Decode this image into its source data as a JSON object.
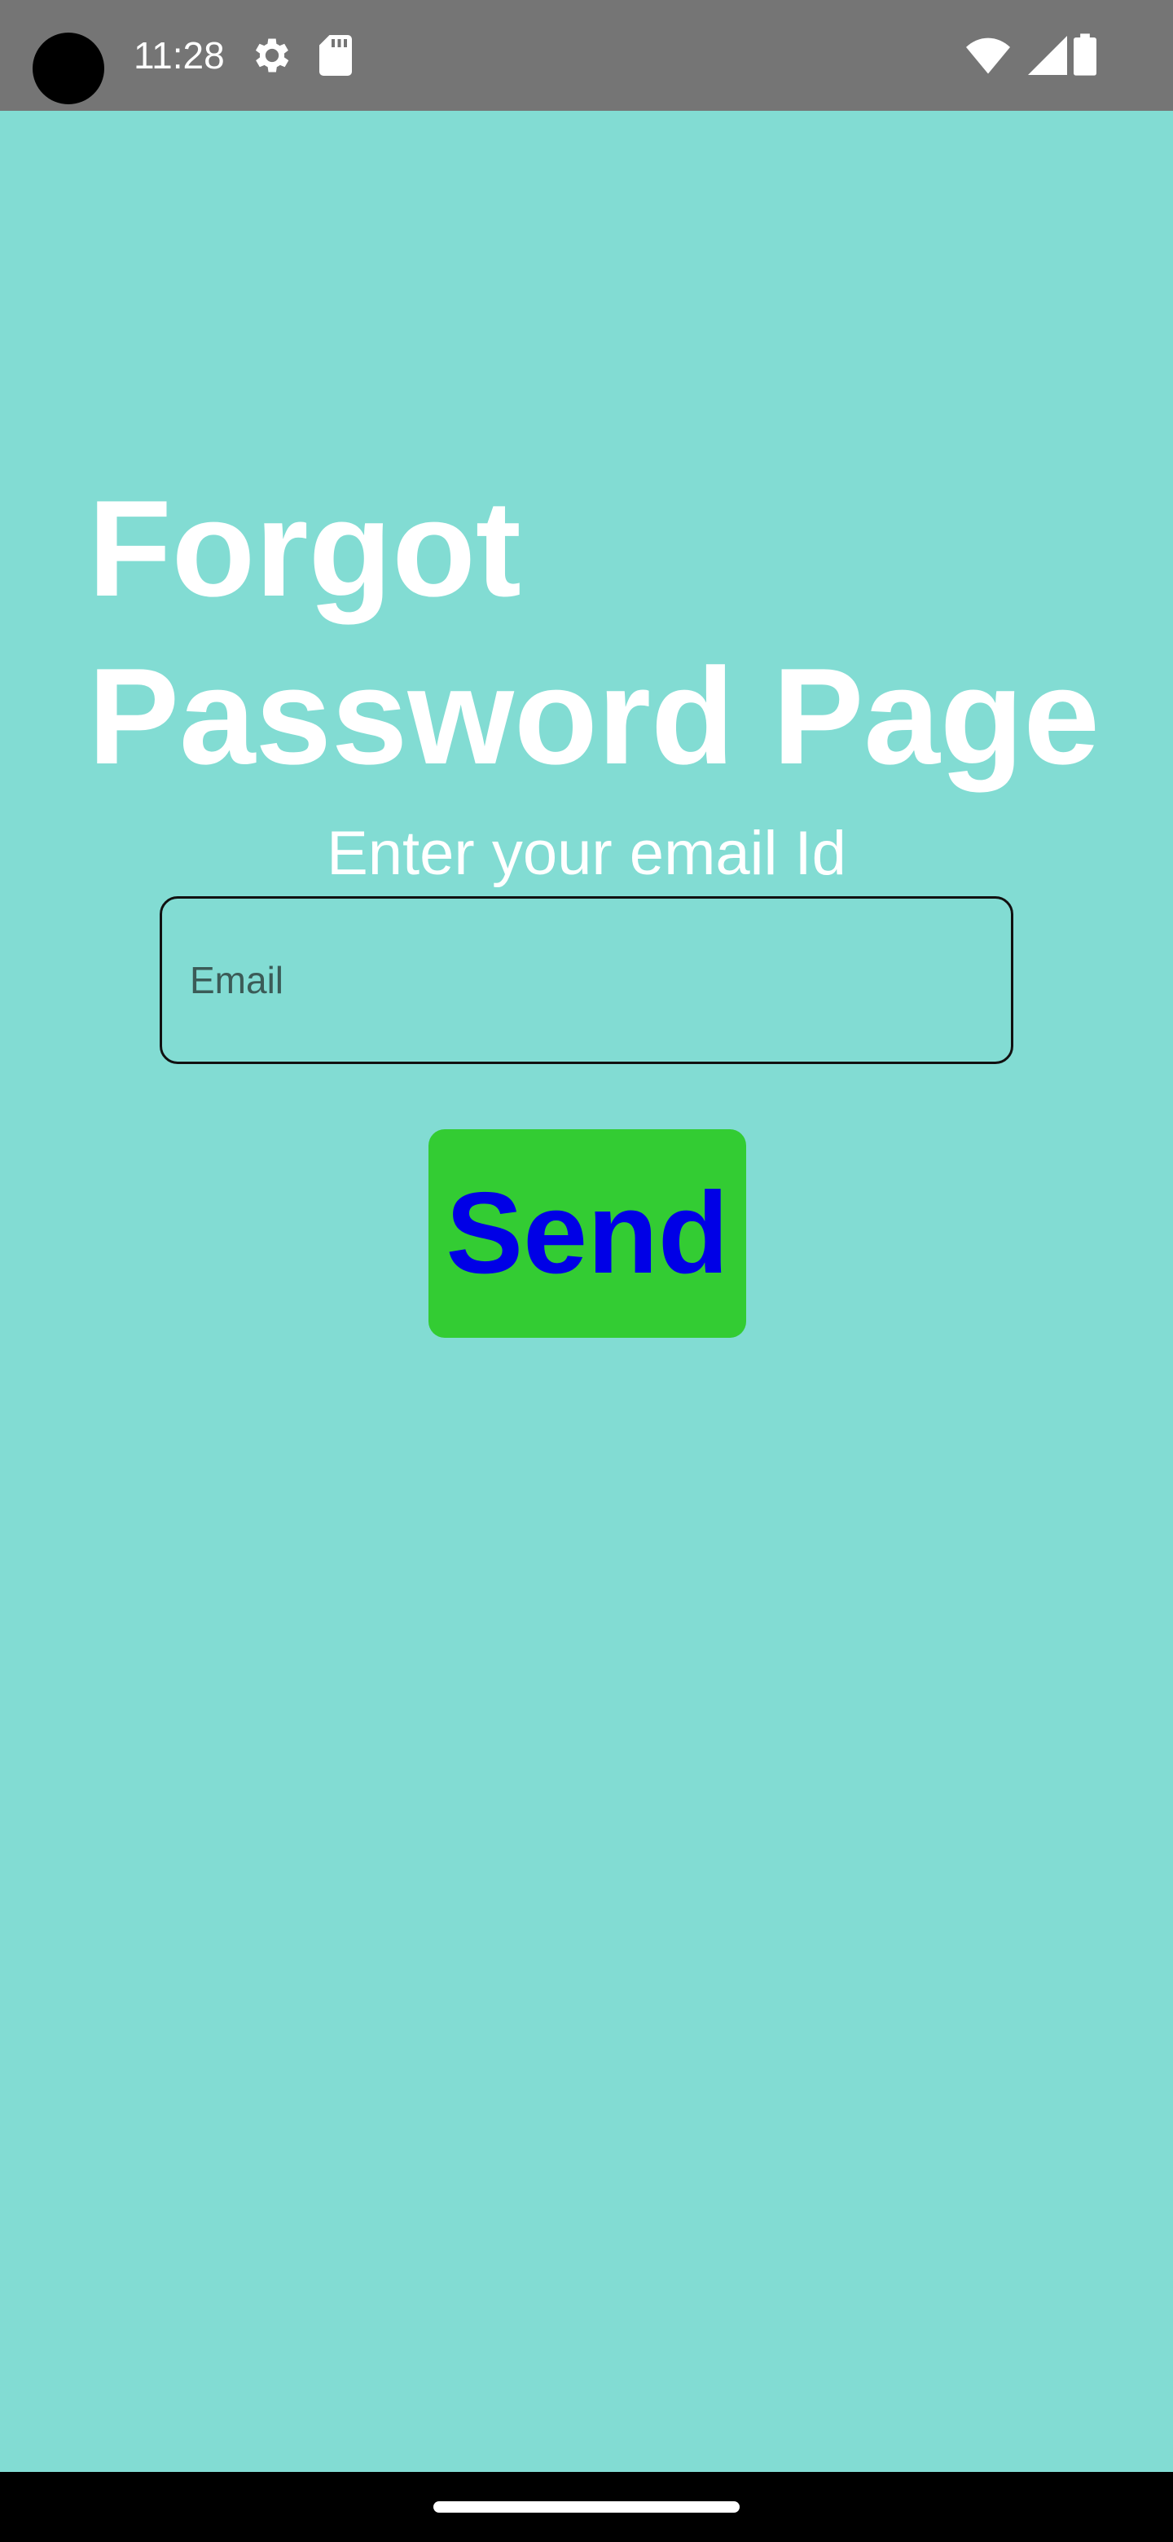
{
  "status_bar": {
    "time": "11:28",
    "icons": [
      "settings-gear-icon",
      "sd-card-icon",
      "wifi-icon",
      "cell-signal-icon",
      "battery-icon"
    ]
  },
  "page": {
    "title_line1": "Forgot",
    "title_line2": "Password Page",
    "subtitle": "Enter your email Id"
  },
  "email_field": {
    "placeholder": "Email",
    "value": ""
  },
  "send_button": {
    "label": "Send"
  },
  "colors": {
    "background": "#82dcd3",
    "status_bar": "#757575",
    "button_bg": "#33cc33",
    "button_text": "#0000e6",
    "title_text": "#ffffff"
  }
}
